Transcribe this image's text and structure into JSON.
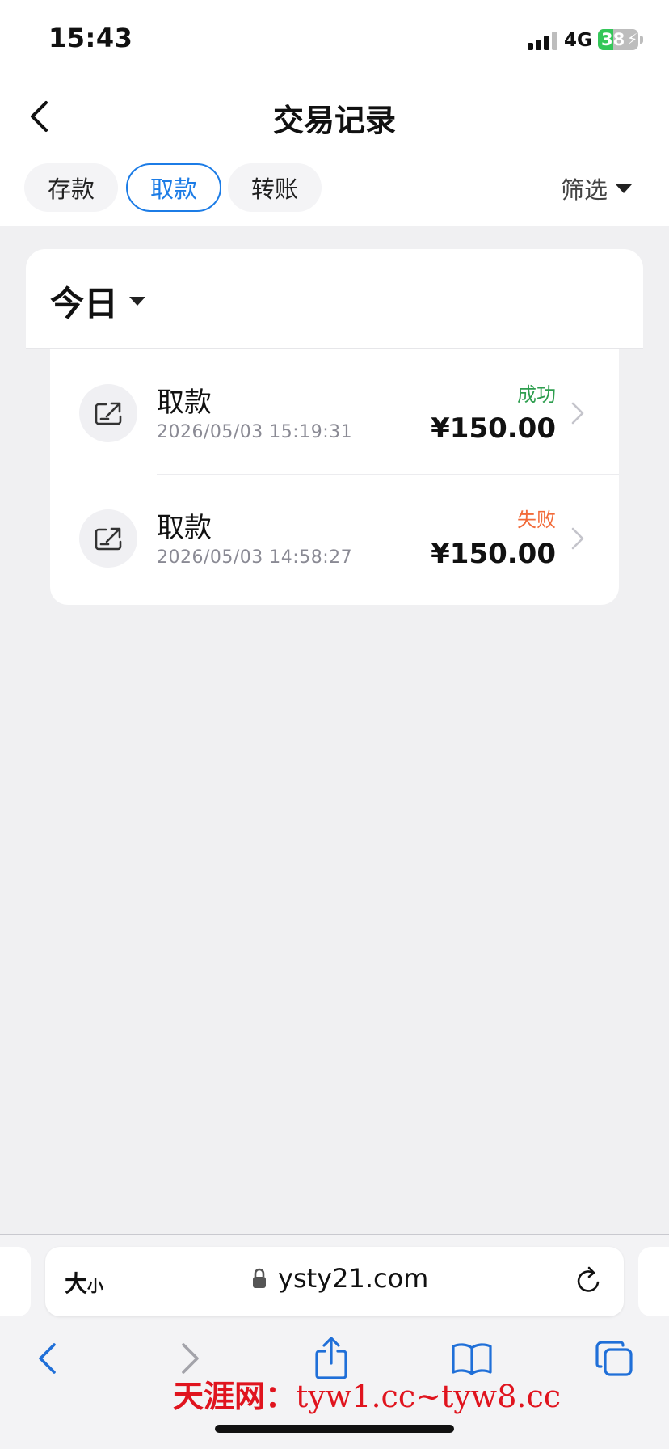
{
  "status_bar": {
    "time": "15:43",
    "network": "4G",
    "battery_text": "38",
    "battery_level": 0.38,
    "battery_color": "#34c759"
  },
  "header": {
    "title": "交易记录",
    "back_icon": "chevron-left-icon",
    "tabs": [
      {
        "label": "存款",
        "active": false
      },
      {
        "label": "取款",
        "active": true
      },
      {
        "label": "转账",
        "active": false
      }
    ],
    "filter_label": "筛选",
    "accent_color": "#1c7ce6"
  },
  "date_filter": {
    "label": "今日"
  },
  "transactions": [
    {
      "title": "取款",
      "time": "2026/05/03 15:19:31",
      "status": "成功",
      "status_color": "#2e9e4f",
      "amount": "¥150.00",
      "icon": "withdraw-icon"
    },
    {
      "title": "取款",
      "time": "2026/05/03 14:58:27",
      "status": "失败",
      "status_color": "#f26b3a",
      "amount": "¥150.00",
      "icon": "withdraw-icon"
    }
  ],
  "browser": {
    "text_size_label": "大",
    "text_size_small": "小",
    "url": "ysty21.com",
    "nav_color": "#1f6fd8"
  },
  "watermark": {
    "brand": "天涯网：",
    "text": "tyw1.cc~tyw8.cc",
    "color": "#e0141e"
  }
}
